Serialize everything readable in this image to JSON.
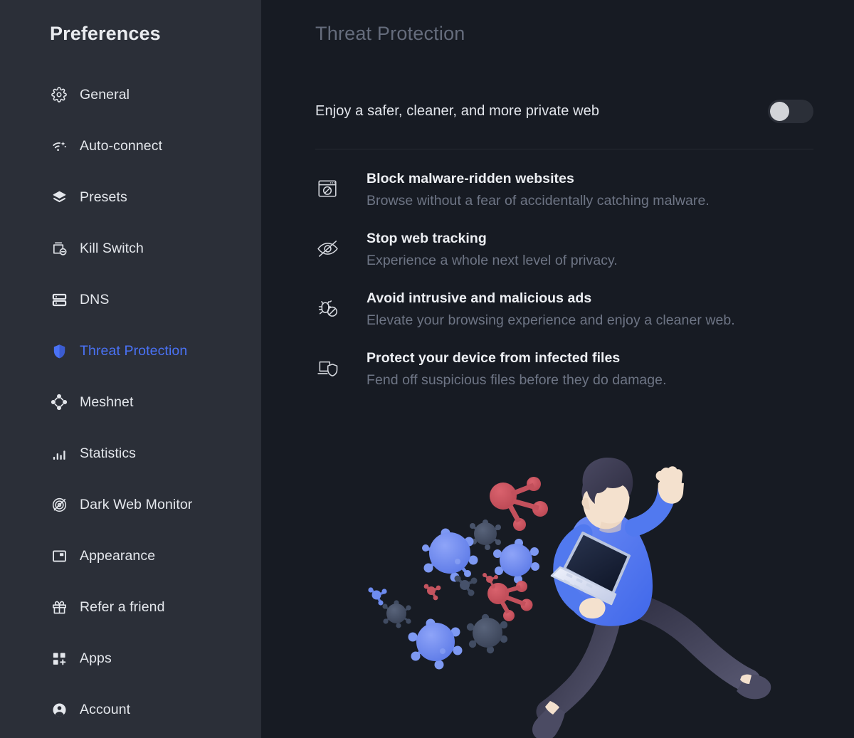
{
  "sidebar": {
    "title": "Preferences",
    "items": [
      {
        "label": "General",
        "icon": "gear-icon",
        "active": false
      },
      {
        "label": "Auto-connect",
        "icon": "auto-connect-icon",
        "active": false
      },
      {
        "label": "Presets",
        "icon": "layers-icon",
        "active": false
      },
      {
        "label": "Kill Switch",
        "icon": "kill-switch-icon",
        "active": false
      },
      {
        "label": "DNS",
        "icon": "server-icon",
        "active": false
      },
      {
        "label": "Threat Protection",
        "icon": "shield-icon",
        "active": true
      },
      {
        "label": "Meshnet",
        "icon": "meshnet-icon",
        "active": false
      },
      {
        "label": "Statistics",
        "icon": "bar-chart-icon",
        "active": false
      },
      {
        "label": "Dark Web Monitor",
        "icon": "target-icon",
        "active": false
      },
      {
        "label": "Appearance",
        "icon": "appearance-icon",
        "active": false
      },
      {
        "label": "Refer a friend",
        "icon": "gift-icon",
        "active": false
      },
      {
        "label": "Apps",
        "icon": "apps-grid-icon",
        "active": false
      },
      {
        "label": "Account",
        "icon": "account-person-icon",
        "active": false
      }
    ]
  },
  "main": {
    "title": "Threat Protection",
    "master": {
      "label": "Enjoy a safer, cleaner, and more private web",
      "toggle_state": "off"
    },
    "features": [
      {
        "icon": "browser-blocked-icon",
        "title": "Block malware-ridden websites",
        "description": "Browse without a fear of accidentally catching malware."
      },
      {
        "icon": "eye-off-icon",
        "title": "Stop web tracking",
        "description": "Experience a whole next level of privacy."
      },
      {
        "icon": "bug-blocked-icon",
        "title": "Avoid intrusive and malicious ads",
        "description": "Elevate your browsing experience and enjoy a cleaner web."
      },
      {
        "icon": "laptop-shield-icon",
        "title": "Protect your device from infected files",
        "description": "Fend off suspicious files before they do damage."
      }
    ],
    "illustration": {
      "name": "person-running-with-laptop-away-from-viruses"
    }
  },
  "colors": {
    "sidebar_bg": "#2b2f38",
    "main_bg": "#171b23",
    "accent_blue": "#4a72f5",
    "text_primary": "#e9ebef",
    "text_muted": "#6e7585",
    "title_muted": "#656c7c",
    "virus_blue": "#6f8df0",
    "virus_grey": "#4b5668",
    "virus_red": "#cf5763",
    "shirt_blue": "#5179ef",
    "skin": "#f6e3d0",
    "hair": "#3a3950",
    "pants": "#4a4a60"
  }
}
